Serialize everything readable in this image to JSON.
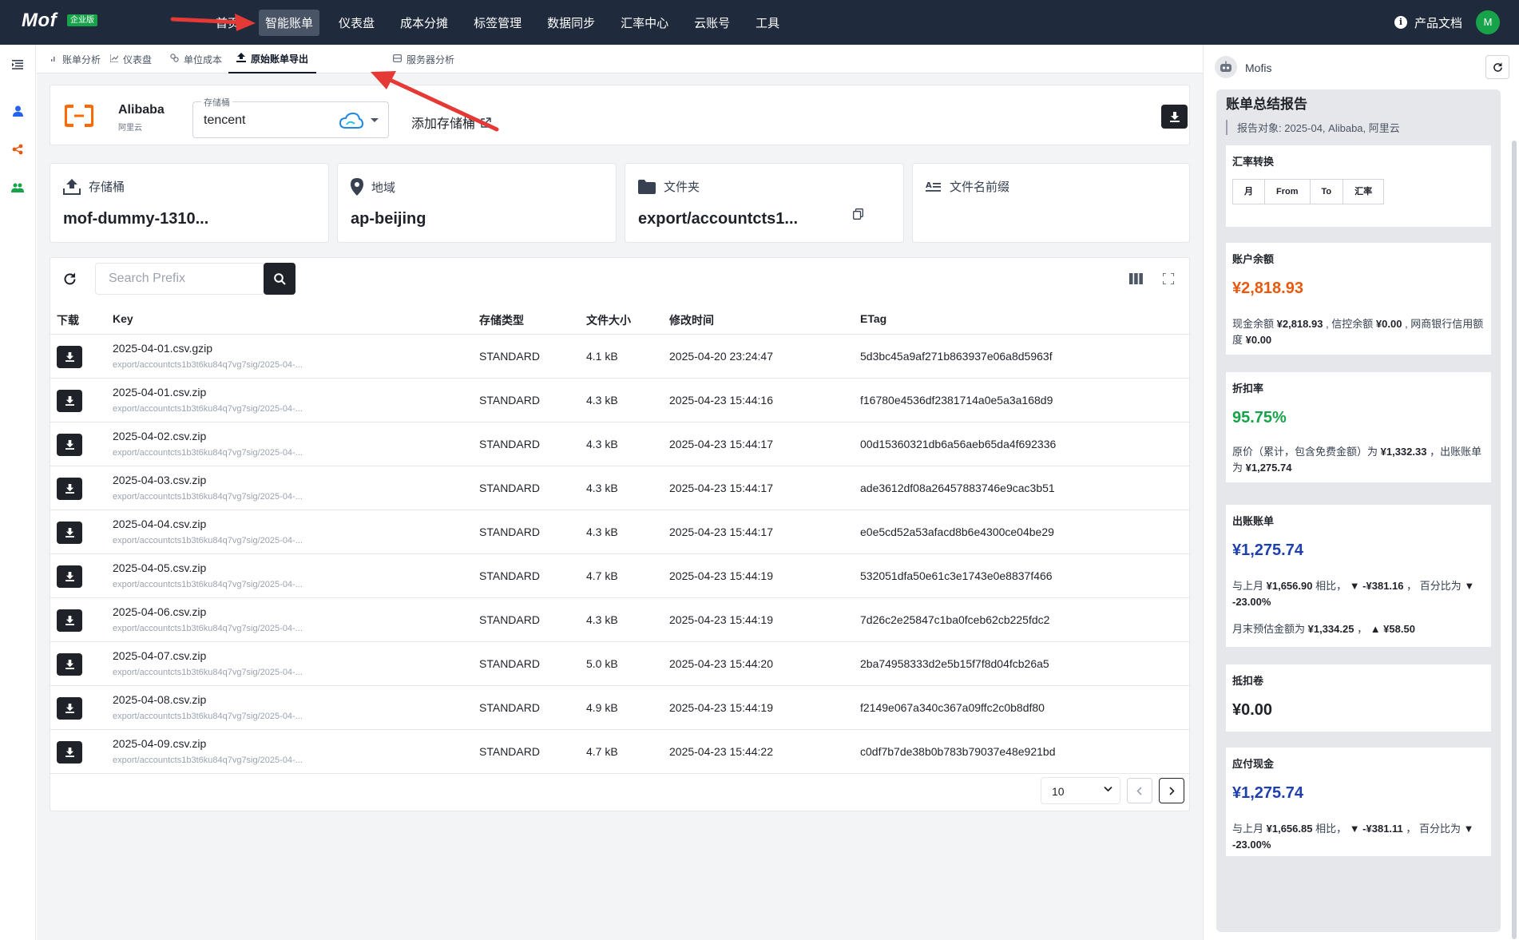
{
  "brand": {
    "name": "Mof",
    "badge": "企业版"
  },
  "topnav": {
    "items": [
      {
        "label": "首页"
      },
      {
        "label": "智能账单",
        "active": true
      },
      {
        "label": "仪表盘"
      },
      {
        "label": "成本分摊"
      },
      {
        "label": "标签管理"
      },
      {
        "label": "数据同步"
      },
      {
        "label": "汇率中心"
      },
      {
        "label": "云账号"
      },
      {
        "label": "工具"
      }
    ],
    "docs_label": "产品文档",
    "user_initial": "M"
  },
  "subtabs": [
    {
      "label": "账单分析",
      "icon": "bar-chart-icon"
    },
    {
      "label": "仪表盘",
      "icon": "line-chart-icon"
    },
    {
      "label": "单位成本",
      "icon": "link-icon"
    },
    {
      "label": "原始账单导出",
      "icon": "upload-icon",
      "active": true
    },
    {
      "label": "服务器分析",
      "icon": "server-icon"
    }
  ],
  "provider": {
    "name": "Alibaba",
    "sub": "阿里云",
    "bucket_label": "存储桶",
    "bucket_value": "tencent",
    "add_bucket_label": "添加存储桶"
  },
  "info_cards": [
    {
      "title": "存储桶",
      "value": "mof-dummy-1310...",
      "icon": "upload-cloud-icon"
    },
    {
      "title": "地域",
      "value": "ap-beijing",
      "icon": "location-pin-icon"
    },
    {
      "title": "文件夹",
      "value": "export/accountcts1...",
      "icon": "folder-icon"
    },
    {
      "title": "文件名前缀",
      "value": "",
      "icon": "text-prefix-icon"
    }
  ],
  "table": {
    "search_placeholder": "Search Prefix",
    "headers": [
      "下载",
      "Key",
      "存储类型",
      "文件大小",
      "修改时间",
      "ETag"
    ],
    "rows": [
      {
        "key": "2025-04-01.csv.gzip",
        "path": "export/accountcts1b3t6ku84q7vg7sig/2025-04-...",
        "storage": "STANDARD",
        "size": "4.1 kB",
        "modified": "2025-04-20 23:24:47",
        "etag": "5d3bc45a9af271b863937e06a8d5963f"
      },
      {
        "key": "2025-04-01.csv.zip",
        "path": "export/accountcts1b3t6ku84q7vg7sig/2025-04-...",
        "storage": "STANDARD",
        "size": "4.3 kB",
        "modified": "2025-04-23 15:44:16",
        "etag": "f16780e4536df2381714a0e5a3a168d9"
      },
      {
        "key": "2025-04-02.csv.zip",
        "path": "export/accountcts1b3t6ku84q7vg7sig/2025-04-...",
        "storage": "STANDARD",
        "size": "4.3 kB",
        "modified": "2025-04-23 15:44:17",
        "etag": "00d15360321db6a56aeb65da4f692336"
      },
      {
        "key": "2025-04-03.csv.zip",
        "path": "export/accountcts1b3t6ku84q7vg7sig/2025-04-...",
        "storage": "STANDARD",
        "size": "4.3 kB",
        "modified": "2025-04-23 15:44:17",
        "etag": "ade3612df08a26457883746e9cac3b51"
      },
      {
        "key": "2025-04-04.csv.zip",
        "path": "export/accountcts1b3t6ku84q7vg7sig/2025-04-...",
        "storage": "STANDARD",
        "size": "4.3 kB",
        "modified": "2025-04-23 15:44:17",
        "etag": "e0e5cd52a53afacd8b6e4300ce04be29"
      },
      {
        "key": "2025-04-05.csv.zip",
        "path": "export/accountcts1b3t6ku84q7vg7sig/2025-04-...",
        "storage": "STANDARD",
        "size": "4.7 kB",
        "modified": "2025-04-23 15:44:19",
        "etag": "532051dfa50e61c3e1743e0e8837f466"
      },
      {
        "key": "2025-04-06.csv.zip",
        "path": "export/accountcts1b3t6ku84q7vg7sig/2025-04-...",
        "storage": "STANDARD",
        "size": "4.3 kB",
        "modified": "2025-04-23 15:44:19",
        "etag": "7d26c2e25847c1ba0fceb62cb225fdc2"
      },
      {
        "key": "2025-04-07.csv.zip",
        "path": "export/accountcts1b3t6ku84q7vg7sig/2025-04-...",
        "storage": "STANDARD",
        "size": "5.0 kB",
        "modified": "2025-04-23 15:44:20",
        "etag": "2ba74958333d2e5b15f7f8d04fcb26a5"
      },
      {
        "key": "2025-04-08.csv.zip",
        "path": "export/accountcts1b3t6ku84q7vg7sig/2025-04-...",
        "storage": "STANDARD",
        "size": "4.9 kB",
        "modified": "2025-04-23 15:44:19",
        "etag": "f2149e067a340c367a09ffc2c0b8df80"
      },
      {
        "key": "2025-04-09.csv.zip",
        "path": "export/accountcts1b3t6ku84q7vg7sig/2025-04-...",
        "storage": "STANDARD",
        "size": "4.7 kB",
        "modified": "2025-04-23 15:44:22",
        "etag": "c0df7b7de38b0b783b79037e48e921bd"
      }
    ],
    "page_size": "10"
  },
  "assistant": {
    "name": "Mofis",
    "report_title": "账单总结报告",
    "report_subject": "报告对象: 2025-04, Alibaba, 阿里云",
    "fx": {
      "title": "汇率转换",
      "headers": [
        "月",
        "From",
        "To",
        "汇率"
      ]
    },
    "balance": {
      "title": "账户余额",
      "amount": "¥2,818.93",
      "text_prefix": "现金余额 ",
      "cash": "¥2,818.93",
      "text_mid1": " , 信控余额 ",
      "credit": "¥0.00",
      "text_mid2": " , 网商银行信用额度 ",
      "bank": "¥0.00"
    },
    "discount": {
      "title": "折扣率",
      "rate": "95.75%",
      "text_prefix": "原价（累计，包含免费金额）为 ",
      "original": "¥1,332.33",
      "text_mid": " ，出账账单为 ",
      "billed": "¥1,275.74"
    },
    "bill": {
      "title": "出账账单",
      "amount": "¥1,275.74",
      "text_prefix": "与上月 ",
      "last_month": "¥1,656.90",
      "text_mid": " 相比， ",
      "change": "▼ -¥381.16",
      "text_mid2": " ， 百分比为 ",
      "pct": "▼ -23.00%",
      "forecast_prefix": "月末预估金额为 ",
      "forecast": "¥1,334.25",
      "forecast_sep": " ， ",
      "forecast_change": "▲ ¥58.50"
    },
    "voucher": {
      "title": "抵扣卷",
      "amount": "¥0.00"
    },
    "cash_due": {
      "title": "应付现金",
      "amount": "¥1,275.74",
      "text_prefix": "与上月 ",
      "last_month": "¥1,656.85",
      "text_mid": " 相比， ",
      "change": "▼ -¥381.11",
      "text_mid2": " ， 百分比为 ",
      "pct": "▼ -23.00%"
    }
  },
  "colors": {
    "nav_bg": "#1f2a3c",
    "accent_green": "#16a34a",
    "alibaba_orange": "#ff6a00",
    "arrow_red": "#e53935"
  }
}
